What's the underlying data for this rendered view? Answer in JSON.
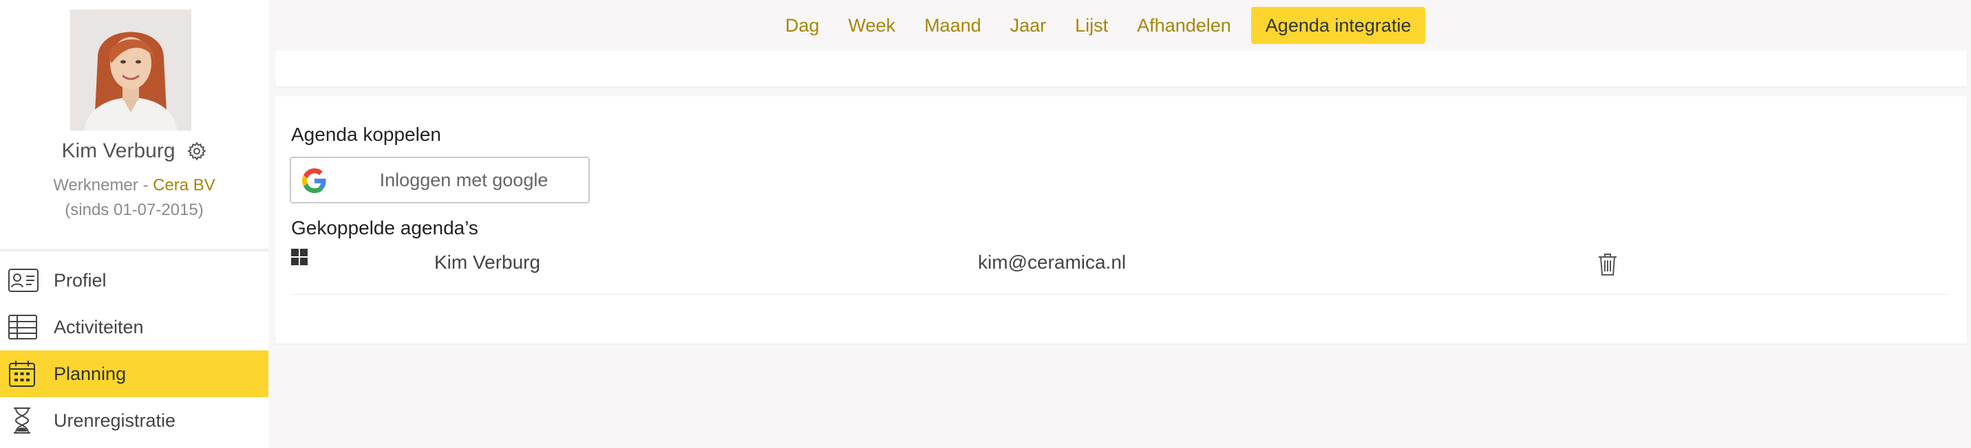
{
  "user": {
    "name": "Kim Verburg",
    "role": "Werknemer",
    "role_separator": " - ",
    "company": "Cera BV",
    "since": "(sinds 01-07-2015)"
  },
  "nav": {
    "items": [
      {
        "label": "Profiel",
        "icon": "profile-card-icon",
        "active": false
      },
      {
        "label": "Activiteiten",
        "icon": "table-icon",
        "active": false
      },
      {
        "label": "Planning",
        "icon": "calendar-icon",
        "active": true
      },
      {
        "label": "Urenregistratie",
        "icon": "hourglass-icon",
        "active": false
      }
    ]
  },
  "tabs": [
    {
      "label": "Dag",
      "active": false
    },
    {
      "label": "Week",
      "active": false
    },
    {
      "label": "Maand",
      "active": false
    },
    {
      "label": "Jaar",
      "active": false
    },
    {
      "label": "Lijst",
      "active": false
    },
    {
      "label": "Afhandelen",
      "active": false
    },
    {
      "label": "Agenda integratie",
      "active": true
    }
  ],
  "integration": {
    "connect_title": "Agenda koppelen",
    "google_button_label": "Inloggen met google",
    "linked_title": "Gekoppelde agenda’s",
    "linked": [
      {
        "provider_icon": "microsoft-icon",
        "name": "Kim Verburg",
        "email": "kim@ceramica.nl"
      }
    ]
  },
  "colors": {
    "accent": "#fcd62e",
    "link": "#a5860d",
    "background": "#f8f6f6"
  }
}
